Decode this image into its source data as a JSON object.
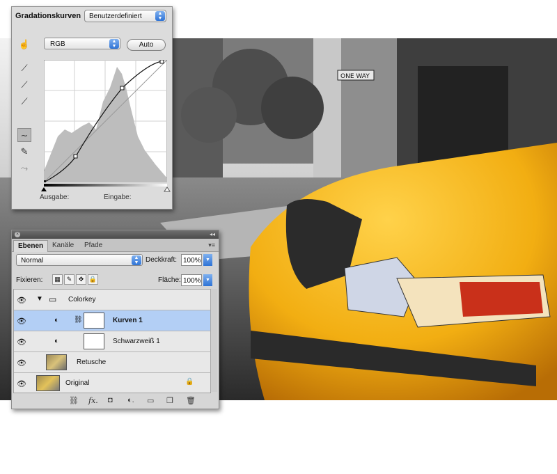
{
  "curves_panel": {
    "title": "Gradationskurven",
    "preset": "Benutzerdefiniert",
    "channel": "RGB",
    "auto_button": "Auto",
    "output_label": "Ausgabe:",
    "input_label": "Eingabe:"
  },
  "layers_panel": {
    "tabs": [
      "Ebenen",
      "Kanäle",
      "Pfade"
    ],
    "blend_mode": "Normal",
    "opacity_label": "Deckkraft:",
    "opacity_value": "100%",
    "lock_label": "Fixieren:",
    "fill_label": "Fläche:",
    "fill_value": "100%",
    "layers": [
      {
        "name": "Colorkey",
        "kind": "group"
      },
      {
        "name": "Kurven 1",
        "kind": "curves-adjustment",
        "selected": true
      },
      {
        "name": "Schwarzweiß 1",
        "kind": "bw-adjustment"
      },
      {
        "name": "Retusche",
        "kind": "pixel"
      },
      {
        "name": "Original",
        "kind": "background",
        "locked": true
      }
    ]
  },
  "scene": {
    "sign_text": "ONE WAY",
    "taxi_color": "#f2b31a"
  }
}
